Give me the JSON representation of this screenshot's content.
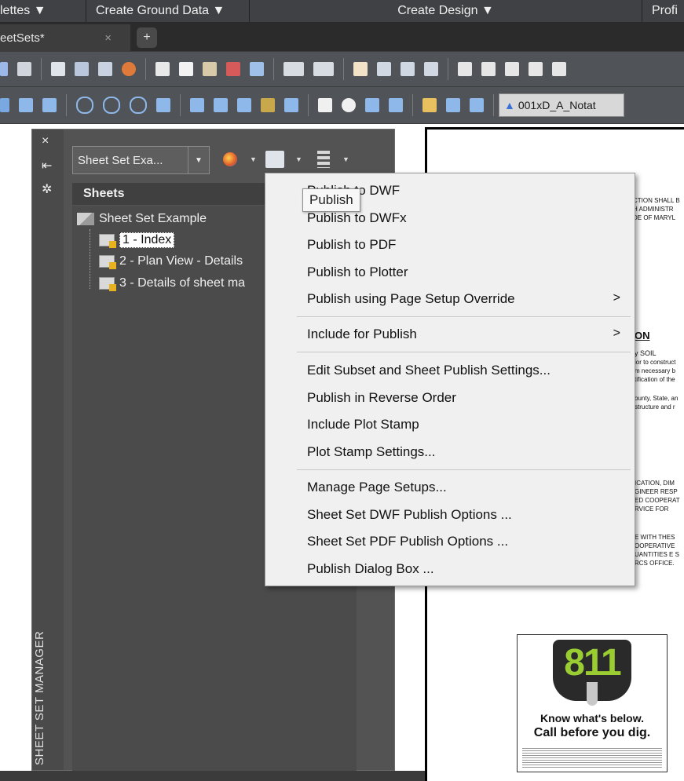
{
  "ribbon": {
    "items": [
      "lettes ▼",
      "Create Ground Data ▼",
      "Create Design ▼",
      "Profi"
    ]
  },
  "tabs": {
    "active": "eetSets*",
    "close": "×",
    "add": "+"
  },
  "toolbar": {
    "layer_name": "001xD_A_Notat"
  },
  "sidebar": {
    "title": "SHEET SET MANAGER",
    "tools": [
      "×",
      "⇤",
      "✲"
    ],
    "combo_value": "Sheet Set Exa...",
    "panel_heading": "Sheets",
    "tree": {
      "root": "Sheet Set Example",
      "sheets": [
        "1 - Index",
        "2 - Plan View - Details",
        "3 - Details of sheet ma"
      ]
    }
  },
  "paper": {
    "text_lines": [
      "CTION SHALL B",
      "H ADMINISTR",
      "DE OF MARYL",
      "ON",
      "y     SOIL",
      "ior to construct",
      "m necessary b",
      "tification of the",
      "ounty, State, an",
      "structure and r",
      "ICATION, DIM",
      "GINEER RESP",
      "ED COOPERAT",
      "RVICE FOR",
      "E WITH THES",
      "OOPERATIVE",
      "UANTITIES E S",
      "RCS OFFICE."
    ],
    "logo": {
      "number": "811",
      "line1": "Know what's below.",
      "line2": "Call before you dig."
    }
  },
  "menu": {
    "tooltip": "Publish",
    "items": [
      {
        "label": "Publish to DWF",
        "submenu": false
      },
      {
        "label": "Publish to DWFx",
        "submenu": false
      },
      {
        "label": "Publish to PDF",
        "submenu": false
      },
      {
        "label": "Publish to Plotter",
        "submenu": false
      },
      {
        "label": "Publish using Page Setup Override",
        "submenu": true
      },
      {
        "label": "Include for Publish",
        "submenu": true
      },
      {
        "label": "Edit Subset and Sheet Publish Settings...",
        "submenu": false
      },
      {
        "label": "Publish in Reverse Order",
        "submenu": false
      },
      {
        "label": "Include Plot Stamp",
        "submenu": false
      },
      {
        "label": "Plot Stamp Settings...",
        "submenu": false
      },
      {
        "label": "Manage Page Setups...",
        "submenu": false
      },
      {
        "label": "Sheet Set DWF Publish Options ...",
        "submenu": false
      },
      {
        "label": "Sheet Set PDF Publish Options ...",
        "submenu": false
      },
      {
        "label": "Publish Dialog Box ...",
        "submenu": false
      }
    ],
    "chevron": ">"
  },
  "colors": {
    "ui_dark": "#3b3b3b",
    "panel": "#535353",
    "menu_bg": "#f0f0f0",
    "accent_blue": "#3b6fd8",
    "logo_green": "#7cb518"
  }
}
